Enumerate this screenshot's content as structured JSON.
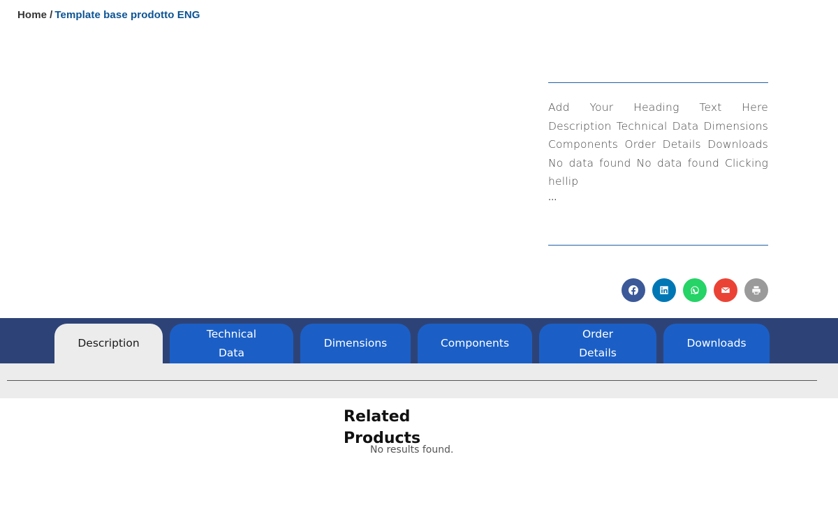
{
  "breadcrumb": {
    "home": "Home",
    "separator": "/",
    "current": "Template base prodotto ENG"
  },
  "summary": {
    "excerpt": "Add Your Heading Text Here Description Technical Data Dimensions Components Order Details Downloads No data found No data found Clicking hellip",
    "ellipsis": "..."
  },
  "share": [
    {
      "icon": "facebook-icon",
      "color": "#3b5998"
    },
    {
      "icon": "linkedin-icon",
      "color": "#0077b5"
    },
    {
      "icon": "whatsapp-icon",
      "color": "#25d366"
    },
    {
      "icon": "email-icon",
      "color": "#ea4335"
    },
    {
      "icon": "print-icon",
      "color": "#9a9a9a"
    }
  ],
  "tabs": [
    {
      "label": "Description"
    },
    {
      "label_line1": "Technical",
      "label_line2": "Data"
    },
    {
      "label": "Dimensions"
    },
    {
      "label": "Components"
    },
    {
      "label_line1": "Order",
      "label_line2": "Details"
    },
    {
      "label": "Downloads"
    }
  ],
  "active_tab": "Description",
  "colors": {
    "tab_band": "#2d4377",
    "tab": "#1b5fc6",
    "tab_active": "#ececec",
    "accent": "#0b5394"
  },
  "related": {
    "title": "Related Products",
    "empty_message": "No results found."
  }
}
